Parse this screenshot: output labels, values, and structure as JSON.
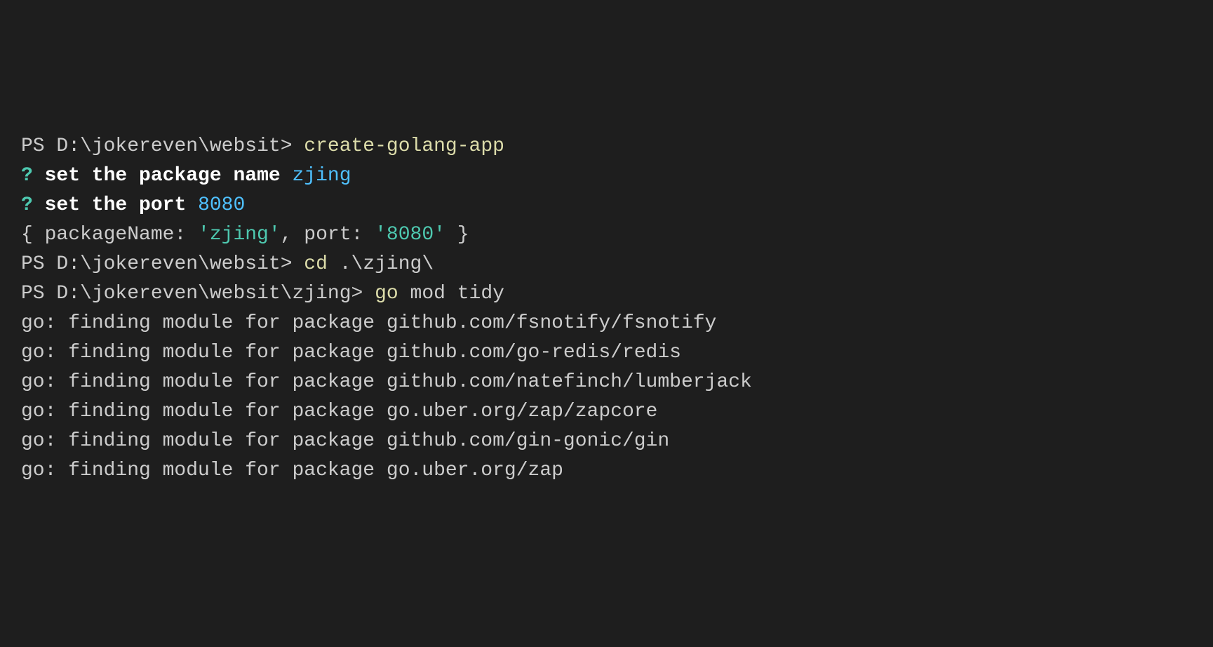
{
  "terminal": {
    "line1": {
      "ps": "PS ",
      "path": "D:\\jokereven\\websit",
      "arrow": "> ",
      "command": "create-golang-app"
    },
    "line2": {
      "qmark": "?",
      "question": " set the package name ",
      "answer": "zjing"
    },
    "line3": {
      "qmark": "?",
      "question": " set the port ",
      "answer": "8080"
    },
    "line4": {
      "open": "{ ",
      "key1": "packageName: ",
      "val1": "'zjing'",
      "comma": ", ",
      "key2": "port: ",
      "val2": "'8080'",
      "close": " }"
    },
    "line5": {
      "ps": "PS ",
      "path": "D:\\jokereven\\websit",
      "arrow": "> ",
      "cmd": "cd",
      "arg": " .\\zjing\\"
    },
    "line6": {
      "ps": "PS ",
      "path": "D:\\jokereven\\websit\\zjing",
      "arrow": "> ",
      "cmd": "go",
      "arg": " mod tidy"
    },
    "line7": "go: finding module for package github.com/fsnotify/fsnotify",
    "line8": "go: finding module for package github.com/go-redis/redis",
    "line9": "go: finding module for package github.com/natefinch/lumberjack",
    "line10": "go: finding module for package go.uber.org/zap/zapcore",
    "line11": "go: finding module for package github.com/gin-gonic/gin",
    "line12": "go: finding module for package go.uber.org/zap"
  }
}
